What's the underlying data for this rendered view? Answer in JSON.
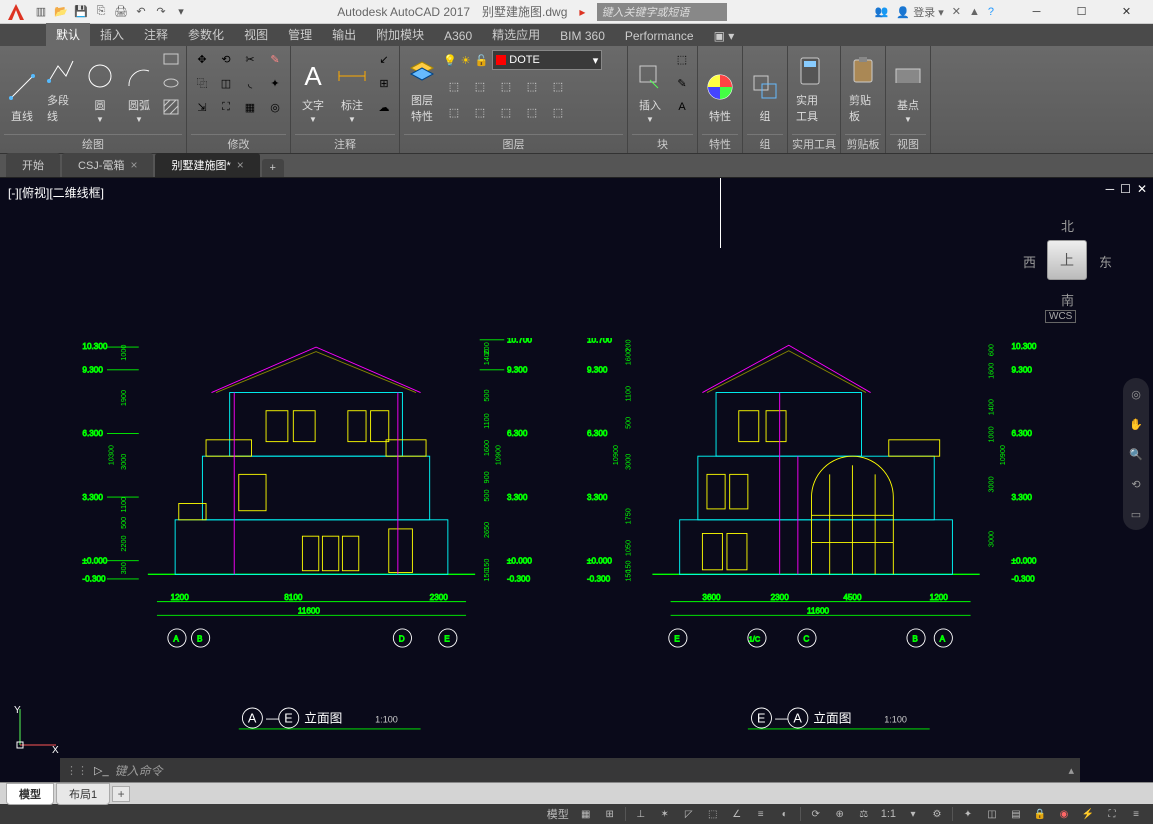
{
  "title": {
    "app": "Autodesk AutoCAD 2017",
    "file": "别墅建施图.dwg",
    "search_placeholder": "键入关键字或短语",
    "login": "登录"
  },
  "ribbon_tabs": [
    "默认",
    "插入",
    "注释",
    "参数化",
    "视图",
    "管理",
    "输出",
    "附加模块",
    "A360",
    "精选应用",
    "BIM 360",
    "Performance"
  ],
  "ribbon": {
    "draw": {
      "title": "绘图",
      "line": "直线",
      "polyline": "多段线",
      "circle": "圆",
      "arc": "圆弧"
    },
    "modify": {
      "title": "修改"
    },
    "annotate": {
      "title": "注释",
      "text": "文字",
      "dim": "标注"
    },
    "layers": {
      "title": "图层",
      "props": "图层\n特性",
      "current": "DOTE"
    },
    "block": {
      "title": "块",
      "insert": "插入"
    },
    "properties": {
      "title": "特性",
      "label": "特性"
    },
    "groups": {
      "title": "组",
      "label": "组"
    },
    "utilities": {
      "title": "实用工具",
      "label": "实用工具"
    },
    "clipboard": {
      "title": "剪贴板",
      "label": "剪贴板"
    },
    "view": {
      "title": "视图",
      "label": "基点"
    }
  },
  "file_tabs": [
    {
      "label": "开始",
      "active": false,
      "closable": false
    },
    {
      "label": "CSJ-電箱",
      "active": false,
      "closable": true
    },
    {
      "label": "别墅建施图*",
      "active": true,
      "closable": true
    }
  ],
  "viewport": {
    "label": "[-][俯视][二维线框]"
  },
  "viewcube": {
    "top": "上",
    "n": "北",
    "s": "南",
    "e": "东",
    "w": "西",
    "wcs": "WCS"
  },
  "drawing": {
    "left": {
      "title_prefix": "A",
      "title_mid": "E",
      "title_text": "立面图",
      "scale": "1:100",
      "elev_marks_left": [
        "10.300",
        "9.300",
        "6.300",
        "3.300",
        "±0.000",
        "-0.300"
      ],
      "elev_marks_right": [
        "10.700",
        "9.300",
        "6.300",
        "3.300",
        "±0.000",
        "-0.300"
      ],
      "heights_left_outer": [
        "10300"
      ],
      "heights_left": [
        "1000",
        "1900",
        "3000",
        "1100",
        "500",
        "2200",
        "300"
      ],
      "heights_right_outer": [
        "10900"
      ],
      "heights_right": [
        "200",
        "1400",
        "500",
        "1100",
        "1600",
        "900",
        "500",
        "2650",
        "150",
        "150"
      ],
      "dims_bottom": [
        "1200",
        "8100",
        "2300"
      ],
      "dim_total": "11600",
      "grids": [
        "A",
        "B",
        "D",
        "E"
      ]
    },
    "right": {
      "title_prefix": "E",
      "title_mid": "A",
      "title_text": "立面图",
      "scale": "1:100",
      "elev_marks_left": [
        "10.700",
        "9.300",
        "6.300",
        "3.300",
        "±0.000",
        "-0.300"
      ],
      "elev_marks_right": [
        "10.300",
        "9.300",
        "6.300",
        "3.300",
        "±0.000",
        "-0.300"
      ],
      "heights_left_outer": [
        "10900"
      ],
      "heights_left": [
        "200",
        "1600",
        "1100",
        "500",
        "3000",
        "1750",
        "1050",
        "150",
        "150"
      ],
      "heights_right_outer": [
        "10900"
      ],
      "heights_right": [
        "600",
        "1600",
        "1400",
        "1000",
        "3000",
        "3000"
      ],
      "dims_bottom": [
        "3600",
        "2300",
        "4500",
        "1200"
      ],
      "dim_total": "11600",
      "grids": [
        "E",
        "1/C",
        "C",
        "B",
        "A"
      ]
    }
  },
  "command": {
    "placeholder": "键入命令"
  },
  "model_tabs": [
    {
      "label": "模型",
      "active": true
    },
    {
      "label": "布局1",
      "active": false
    }
  ],
  "statusbar": {
    "model": "模型",
    "scale": "1:1"
  }
}
